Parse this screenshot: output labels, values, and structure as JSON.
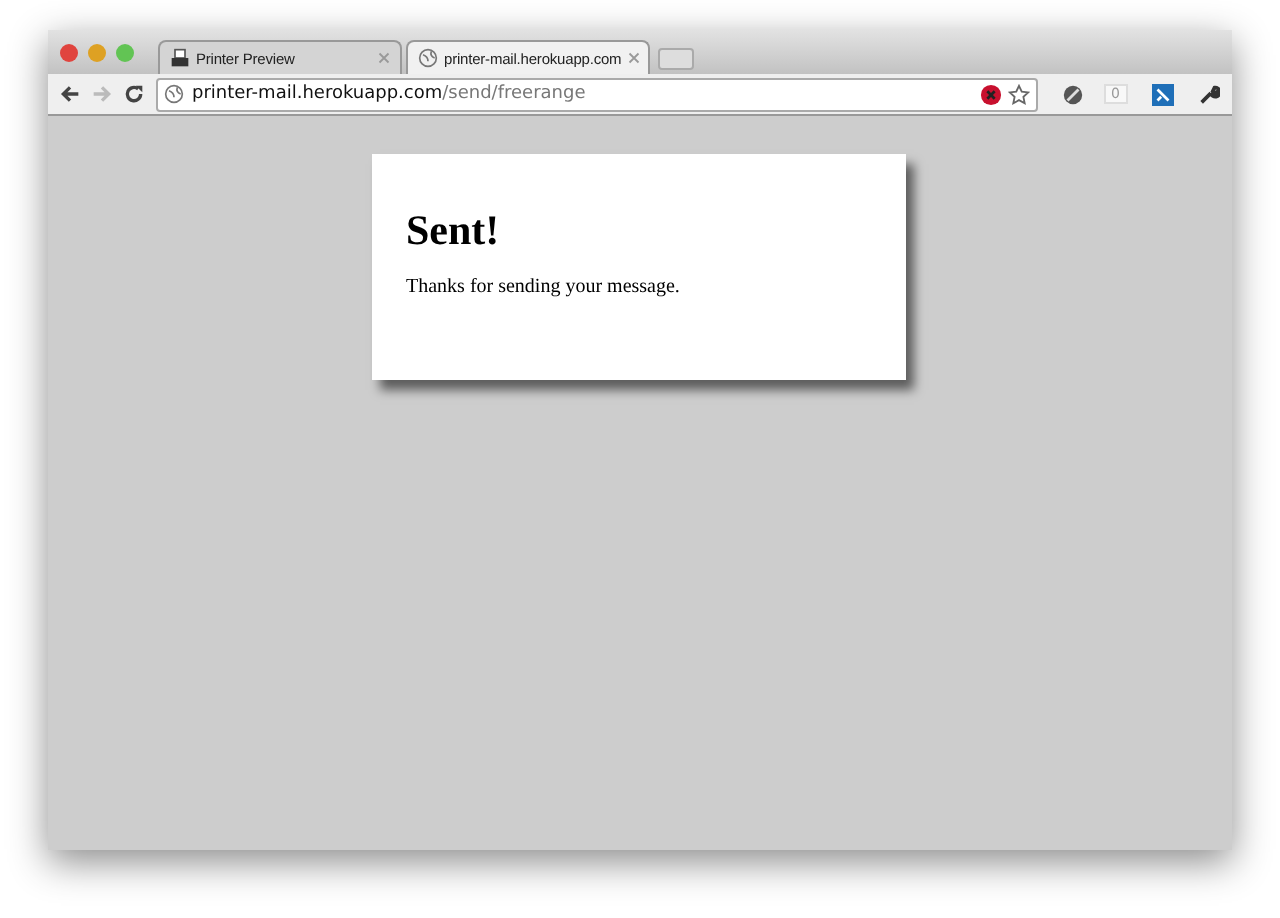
{
  "tabs": [
    {
      "title": "Printer Preview",
      "selected": false
    },
    {
      "title": "printer-mail.herokuapp.com",
      "selected": true
    }
  ],
  "address": {
    "host": "printer-mail.herokuapp.com",
    "path": "/send/freerange"
  },
  "extension_badge": "0",
  "card": {
    "heading": "Sent!",
    "message": "Thanks for sending your message."
  }
}
